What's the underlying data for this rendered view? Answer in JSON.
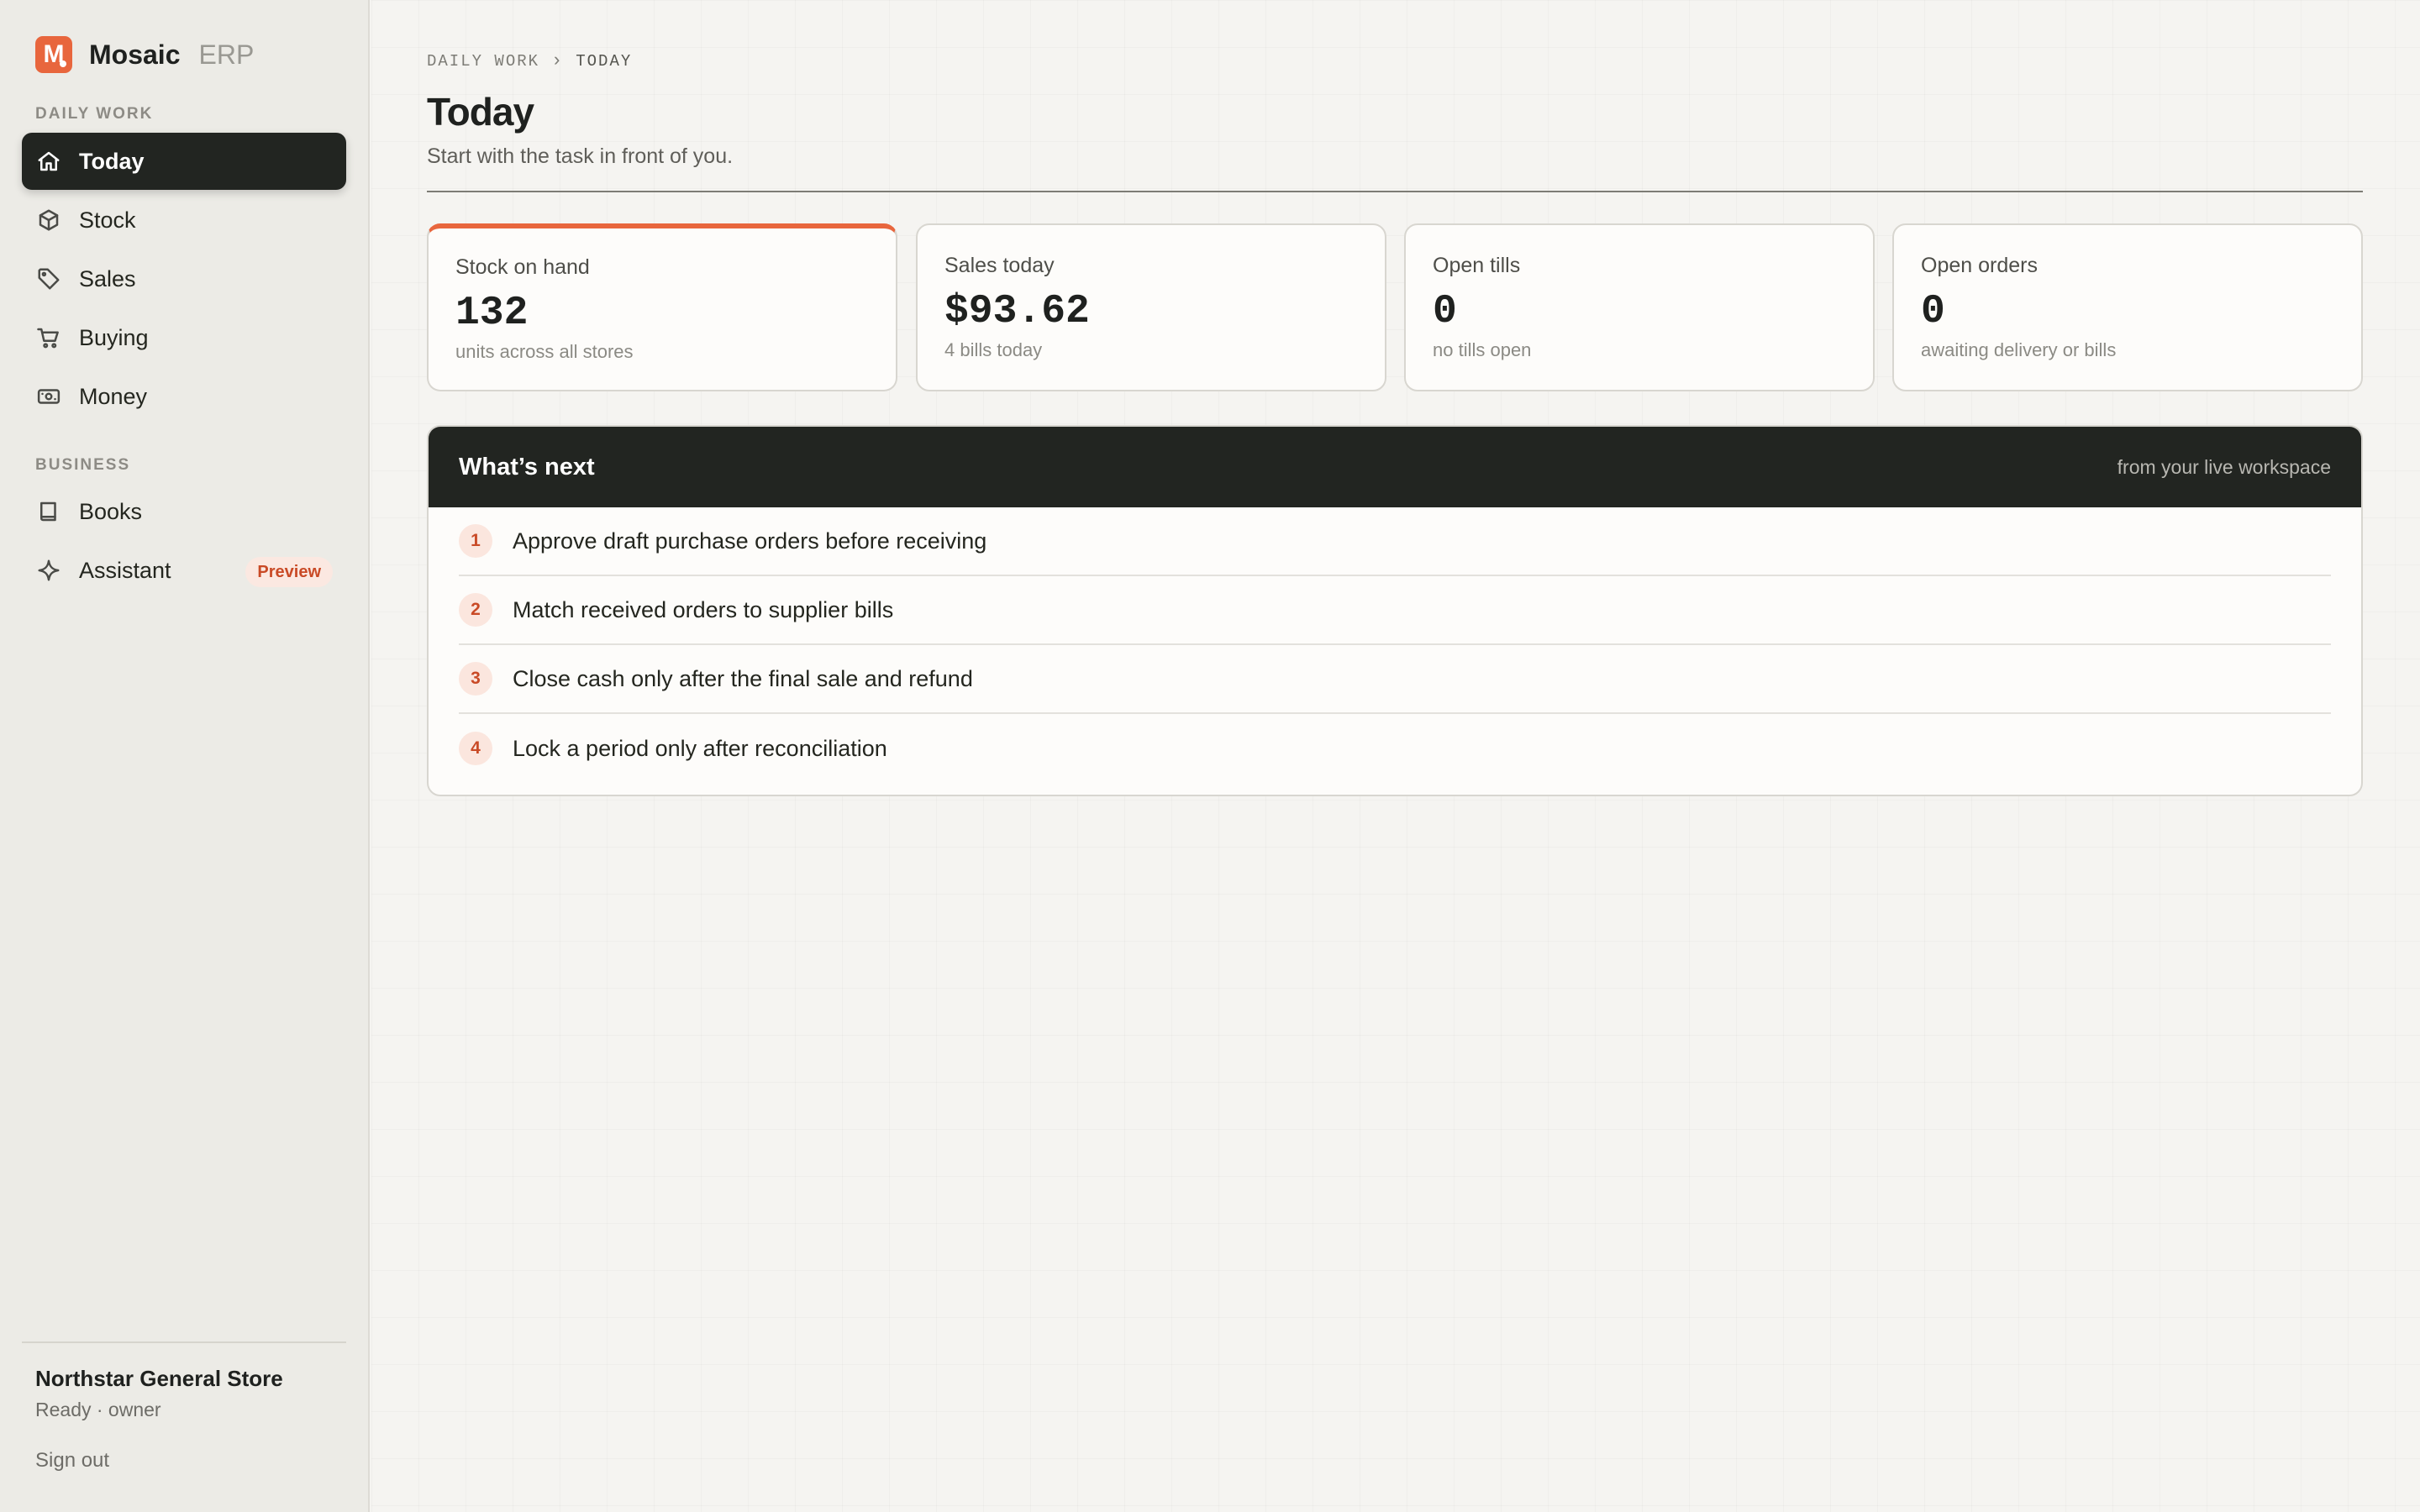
{
  "brand": {
    "logo_letter": "M",
    "name": "Mosaic",
    "suffix": "ERP",
    "accent_color": "#e8663d"
  },
  "sidebar": {
    "sections": [
      {
        "label": "DAILY WORK"
      },
      {
        "label": "BUSINESS"
      }
    ],
    "items": [
      {
        "label": "Today",
        "icon": "home-icon",
        "active": true
      },
      {
        "label": "Stock",
        "icon": "box-icon"
      },
      {
        "label": "Sales",
        "icon": "tag-icon"
      },
      {
        "label": "Buying",
        "icon": "cart-icon"
      },
      {
        "label": "Money",
        "icon": "cash-icon"
      },
      {
        "label": "Books",
        "icon": "book-icon"
      },
      {
        "label": "Assistant",
        "icon": "sparkle-icon",
        "badge": "Preview"
      }
    ],
    "footer": {
      "store_name": "Northstar General Store",
      "store_meta": "Ready · owner",
      "sign_out": "Sign out"
    }
  },
  "main": {
    "breadcrumb": {
      "parent": "DAILY WORK",
      "current": "TODAY"
    },
    "title": "Today",
    "subtitle": "Start with the task in front of you.",
    "stats": [
      {
        "label": "Stock on hand",
        "value": "132",
        "note": "units across all stores"
      },
      {
        "label": "Sales today",
        "value": "$93.62",
        "note": "4 bills today"
      },
      {
        "label": "Open tills",
        "value": "0",
        "note": "no tills open"
      },
      {
        "label": "Open orders",
        "value": "0",
        "note": "awaiting delivery or bills"
      }
    ],
    "next": {
      "title": "What’s next",
      "source": "from your live workspace",
      "tasks": [
        {
          "num": "1",
          "label": "Approve draft purchase orders before receiving"
        },
        {
          "num": "2",
          "label": "Match received orders to supplier bills"
        },
        {
          "num": "3",
          "label": "Close cash only after the final sale and refund"
        },
        {
          "num": "4",
          "label": "Lock a period only after reconciliation"
        }
      ]
    }
  }
}
